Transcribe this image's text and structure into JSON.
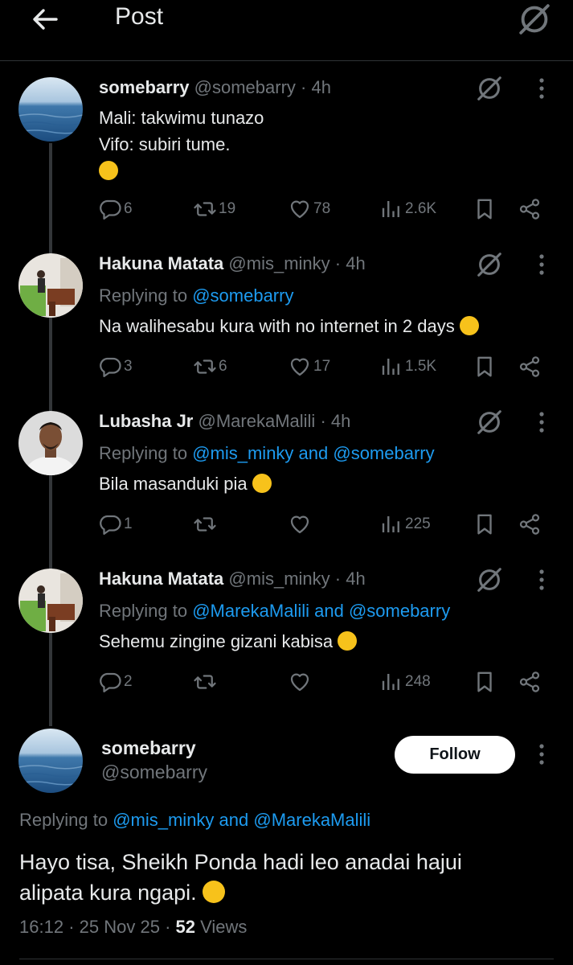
{
  "header": {
    "title": "Post"
  },
  "thread": [
    {
      "name": "somebarry",
      "handle": "@somebarry",
      "time": "· 4h",
      "lines": [
        "Mali: takwimu tunazo",
        "Vifo: subiri tume."
      ],
      "emoji": "😅",
      "replies": "6",
      "reposts": "19",
      "likes": "78",
      "views": "2.6K"
    },
    {
      "name": "Hakuna Matata",
      "handle": "@mis_minky",
      "time": "· 4h",
      "replying_prefix": "Replying to",
      "replying_to": "@somebarry",
      "text": "Na walihesabu kura with no internet in 2 days",
      "emoji": "🤭",
      "replies": "3",
      "reposts": "6",
      "likes": "17",
      "views": "1.5K"
    },
    {
      "name": "Lubasha Jr",
      "handle": "@MarekaMalili",
      "time": "· 4h",
      "replying_prefix": "Replying to",
      "replying_to": "@mis_minky and @somebarry",
      "text": "Bila masanduki pia",
      "emoji": "🤣",
      "replies": "1",
      "reposts": "",
      "likes": "",
      "views": "225"
    },
    {
      "name": "Hakuna Matata",
      "handle": "@mis_minky",
      "time": "· 4h",
      "replying_prefix": "Replying to",
      "replying_to": "@MarekaMalili and @somebarry",
      "text": "Sehemu zingine gizani kabisa",
      "emoji": "🤭",
      "replies": "2",
      "reposts": "",
      "likes": "",
      "views": "248"
    }
  ],
  "main": {
    "name": "somebarry",
    "handle": "@somebarry",
    "follow_label": "Follow",
    "replying_prefix": "Replying to",
    "replying_to": "@mis_minky and @MarekaMalili",
    "text_line1": "Hayo tisa, Sheikh Ponda hadi leo anadai hajui",
    "text_line2": "alipata kura ngapi.",
    "emoji": "😂",
    "time": "16:12",
    "date": "25 Nov 25",
    "views_count": "52",
    "views_label": "Views"
  },
  "icons": [
    "back-arrow-icon",
    "grok-icon",
    "more-icon",
    "reply-icon",
    "repost-icon",
    "like-icon",
    "views-icon",
    "bookmark-icon",
    "share-icon"
  ],
  "colors": {
    "background": "#000000",
    "text": "#e7e9ea",
    "muted": "#71767b",
    "link": "#1d9bf0",
    "divider": "#2f3336"
  }
}
